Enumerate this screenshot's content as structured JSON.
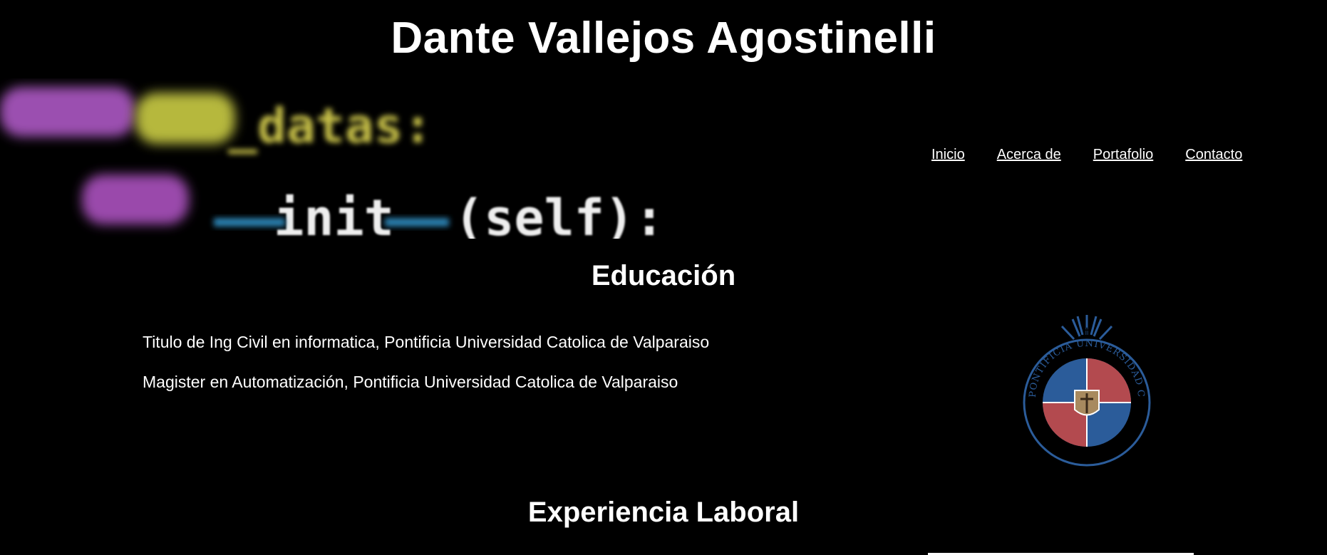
{
  "header": {
    "title": "Dante Vallejos Agostinelli"
  },
  "hero": {
    "code_line_1": "_datas:",
    "code_line_2": "__init__(self):"
  },
  "nav": {
    "items": [
      {
        "label": "Inicio"
      },
      {
        "label": "Acerca de"
      },
      {
        "label": "Portafolio"
      },
      {
        "label": "Contacto"
      }
    ]
  },
  "education": {
    "title": "Educación",
    "items": [
      "Titulo de Ing Civil en informatica, Pontificia Universidad Catolica de Valparaiso",
      "Magister en Automatización, Pontificia Universidad Catolica de Valparaiso"
    ],
    "seal_text": "PONTIFICIA UNIVERSIDAD CATOLICA DE VALPARAISO"
  },
  "work": {
    "title": "Experiencia Laboral"
  },
  "colors": {
    "background": "#000000",
    "text": "#ffffff",
    "seal_blue": "#2b5c9a",
    "seal_red": "#b34a4f",
    "seal_gold": "#a88a5f"
  }
}
